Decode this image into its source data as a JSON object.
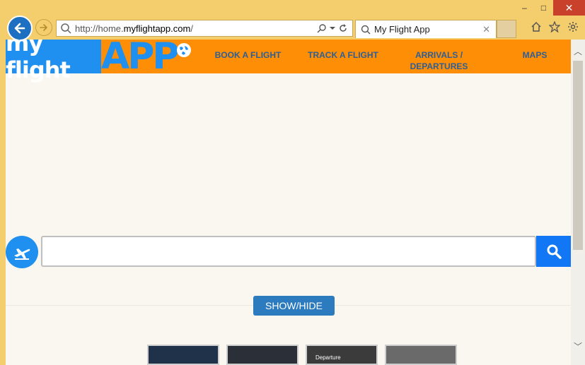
{
  "browser": {
    "url_prefix": "http://home.",
    "url_domain": "myflightapp.com",
    "url_suffix": "/",
    "tab_title": "My Flight App",
    "window_controls": {
      "minimize": "–",
      "maximize": "□",
      "close": "✕"
    }
  },
  "site": {
    "logo_text": "my flight",
    "logo_app": "APP",
    "nav": [
      {
        "label": "BOOK A FLIGHT"
      },
      {
        "label": "TRACK A FLIGHT"
      },
      {
        "label": "ARRIVALS /",
        "label2": "DEPARTURES"
      },
      {
        "label": "MAPS"
      }
    ],
    "search": {
      "value": "",
      "placeholder": ""
    },
    "show_hide_label": "SHOW/HIDE",
    "thumbnails": [
      {
        "label": ""
      },
      {
        "label": ""
      },
      {
        "label": "Departure"
      },
      {
        "label": ""
      }
    ]
  },
  "colors": {
    "chrome": "#f4cd6c",
    "nav_bar": "#fd8e06",
    "brand_blue": "#1f8ff0",
    "search_button": "#1277f5",
    "show_hide": "#2c7bbf"
  },
  "icons": {
    "back": "back-arrow-icon",
    "forward": "forward-arrow-icon",
    "search": "search-icon",
    "refresh": "refresh-icon",
    "home": "home-icon",
    "favorites": "star-icon",
    "settings": "gear-icon",
    "plane": "plane-icon",
    "globe": "globe-icon"
  }
}
